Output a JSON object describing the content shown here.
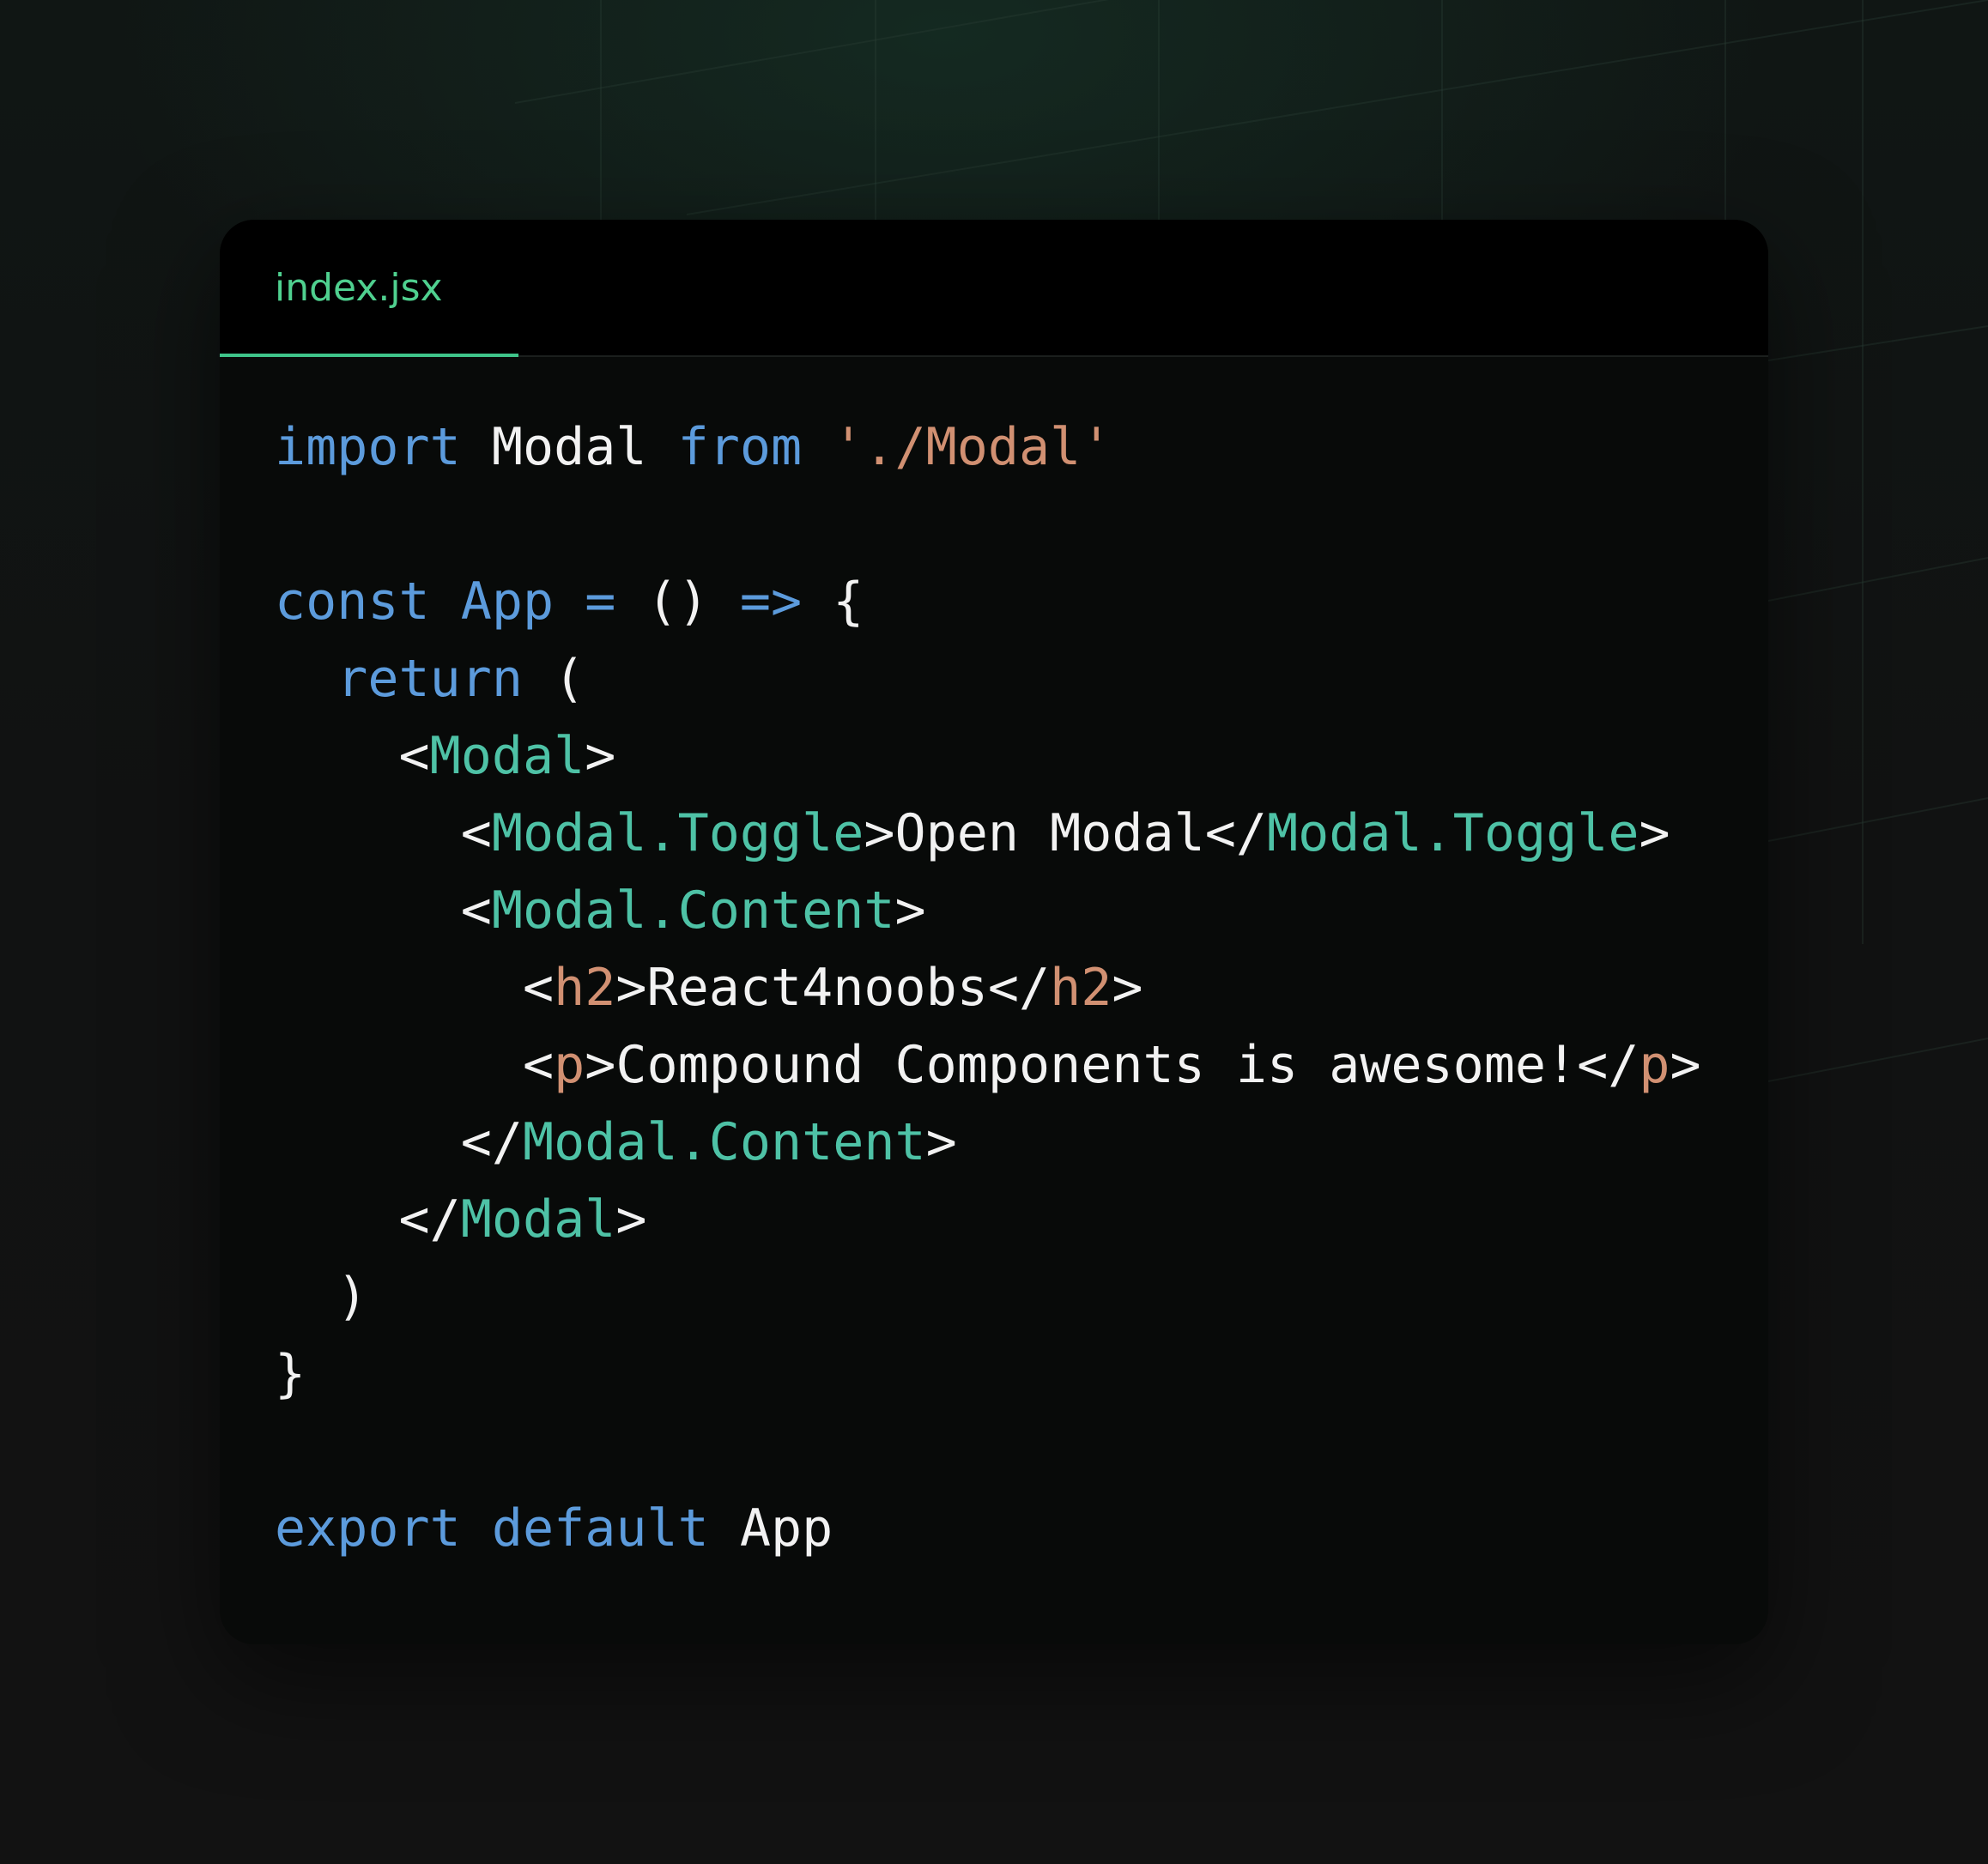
{
  "tab": {
    "label": "index.jsx"
  },
  "colors": {
    "keyword": "#5c9bdc",
    "string": "#d19072",
    "component": "#4ec2a6",
    "html_tag": "#d19072",
    "text": "#f2f2f2",
    "tab_accent": "#3fc48a"
  },
  "code": [
    [
      {
        "t": "kw",
        "v": "import"
      },
      {
        "t": "plain",
        "v": " Modal "
      },
      {
        "t": "kw",
        "v": "from"
      },
      {
        "t": "plain",
        "v": " "
      },
      {
        "t": "str",
        "v": "'./Modal'"
      }
    ],
    [],
    [
      {
        "t": "kw",
        "v": "const"
      },
      {
        "t": "plain",
        "v": " "
      },
      {
        "t": "kw",
        "v": "App"
      },
      {
        "t": "plain",
        "v": " "
      },
      {
        "t": "kw",
        "v": "="
      },
      {
        "t": "plain",
        "v": " () "
      },
      {
        "t": "kw",
        "v": "=>"
      },
      {
        "t": "plain",
        "v": " {"
      }
    ],
    [
      {
        "t": "plain",
        "v": "  "
      },
      {
        "t": "kw",
        "v": "return"
      },
      {
        "t": "plain",
        "v": " ("
      }
    ],
    [
      {
        "t": "plain",
        "v": "    <"
      },
      {
        "t": "comp",
        "v": "Modal"
      },
      {
        "t": "plain",
        "v": ">"
      }
    ],
    [
      {
        "t": "plain",
        "v": "      <"
      },
      {
        "t": "comp",
        "v": "Modal.Toggle"
      },
      {
        "t": "plain",
        "v": ">Open Modal</"
      },
      {
        "t": "comp",
        "v": "Modal.Toggle"
      },
      {
        "t": "plain",
        "v": ">"
      }
    ],
    [
      {
        "t": "plain",
        "v": "      <"
      },
      {
        "t": "comp",
        "v": "Modal.Content"
      },
      {
        "t": "plain",
        "v": ">"
      }
    ],
    [
      {
        "t": "plain",
        "v": "        <"
      },
      {
        "t": "html",
        "v": "h2"
      },
      {
        "t": "plain",
        "v": ">React4noobs</"
      },
      {
        "t": "html",
        "v": "h2"
      },
      {
        "t": "plain",
        "v": ">"
      }
    ],
    [
      {
        "t": "plain",
        "v": "        <"
      },
      {
        "t": "html",
        "v": "p"
      },
      {
        "t": "plain",
        "v": ">Compound Components is awesome!</"
      },
      {
        "t": "html",
        "v": "p"
      },
      {
        "t": "plain",
        "v": ">"
      }
    ],
    [
      {
        "t": "plain",
        "v": "      </"
      },
      {
        "t": "comp",
        "v": "Modal.Content"
      },
      {
        "t": "plain",
        "v": ">"
      }
    ],
    [
      {
        "t": "plain",
        "v": "    </"
      },
      {
        "t": "comp",
        "v": "Modal"
      },
      {
        "t": "plain",
        "v": ">"
      }
    ],
    [
      {
        "t": "plain",
        "v": "  )"
      }
    ],
    [
      {
        "t": "plain",
        "v": "}"
      }
    ],
    [],
    [
      {
        "t": "kw",
        "v": "export"
      },
      {
        "t": "plain",
        "v": " "
      },
      {
        "t": "kw",
        "v": "default"
      },
      {
        "t": "plain",
        "v": " App"
      }
    ]
  ]
}
